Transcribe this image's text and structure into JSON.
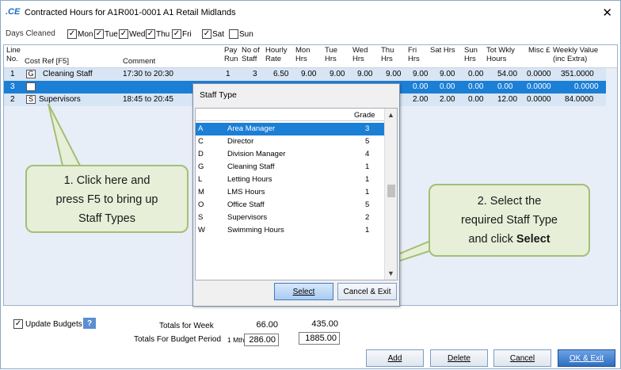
{
  "window": {
    "logo": ".CE",
    "title": "Contracted Hours for A1R001-0001 A1 Retail Midlands",
    "close_glyph": "✕"
  },
  "days": {
    "label": "Days Cleaned",
    "items": [
      {
        "label": "Mon",
        "checked": true
      },
      {
        "label": "Tue",
        "checked": true
      },
      {
        "label": "Wed",
        "checked": true
      },
      {
        "label": "Thu",
        "checked": true
      },
      {
        "label": "Fri",
        "checked": true
      },
      {
        "label": "Sat",
        "checked": true
      },
      {
        "label": "Sun",
        "checked": false
      }
    ]
  },
  "grid": {
    "headers": {
      "line": "Line No.",
      "cost_ref": "Cost Ref [F5]",
      "comment": "Comment",
      "pay_run": "Pay Run",
      "no_staff": "No of Staff",
      "hourly_rate": "Hourly Rate",
      "mon": "Mon Hrs",
      "tue": "Tue Hrs",
      "wed": "Wed Hrs",
      "thu": "Thu Hrs",
      "fri": "Fri Hrs",
      "sat": "Sat Hrs",
      "sun": "Sun Hrs",
      "tot": "Tot Wkly Hours",
      "misc": "Misc £",
      "weekly_value": "Weekly Value (inc Extra)"
    },
    "rows": [
      {
        "line": "1",
        "code": "G",
        "cost_ref": "Cleaning Staff",
        "comment": "17:30 to 20:30",
        "pay_run": "1",
        "no_staff": "3",
        "rate": "6.50",
        "mon": "9.00",
        "tue": "9.00",
        "wed": "9.00",
        "thu": "9.00",
        "fri": "9.00",
        "sat": "9.00",
        "sun": "0.00",
        "tot": "54.00",
        "misc": "0.0000",
        "value": "351.0000"
      },
      {
        "line": "3",
        "code": "",
        "cost_ref": "",
        "comment": "",
        "fri": "0.00",
        "sat": "0.00",
        "sun": "0.00",
        "tot": "0.00",
        "misc": "0.0000",
        "value": "0.0000"
      },
      {
        "line": "2",
        "code": "S",
        "cost_ref": "Supervisors",
        "comment": "18:45 to 20:45",
        "fri": "2.00",
        "sat": "2.00",
        "sun": "0.00",
        "tot": "12.00",
        "misc": "0.0000",
        "value": "84.0000"
      }
    ]
  },
  "popup": {
    "title": "Staff Type",
    "grade_header": "Grade",
    "items": [
      {
        "code": "A",
        "name": "Area Manager",
        "grade": "3"
      },
      {
        "code": "C",
        "name": "Director",
        "grade": "5"
      },
      {
        "code": "D",
        "name": "Division Manager",
        "grade": "4"
      },
      {
        "code": "G",
        "name": " Cleaning Staff",
        "grade": "1"
      },
      {
        "code": "L",
        "name": "Letting Hours",
        "grade": "1"
      },
      {
        "code": "M",
        "name": "LMS Hours",
        "grade": "1"
      },
      {
        "code": "O",
        "name": "Office Staff",
        "grade": "5"
      },
      {
        "code": "S",
        "name": " Supervisors",
        "grade": "2"
      },
      {
        "code": "W",
        "name": "Swimming Hours",
        "grade": "1"
      }
    ],
    "select_label": "Select",
    "cancel_label": "Cancel & Exit"
  },
  "callouts": {
    "one_line1": "1.    Click here and",
    "one_line2": "press F5 to bring up",
    "one_line3": "Staff Types",
    "two_line1": "2.    Select the",
    "two_line2": "required Staff Type",
    "two_line3_prefix": "and click ",
    "two_line3_bold": "Select"
  },
  "footer": {
    "update_budgets": "Update Budgets",
    "help": "?",
    "totals_week_label": "Totals for Week",
    "totals_week_hours": "66.00",
    "totals_week_value": "435.00",
    "totals_budget_label": "Totals For Budget Period",
    "period_unit": "1 Mth",
    "budget_hours": "286.00",
    "budget_value": "1885.00",
    "add": "Add",
    "delete": "Delete",
    "cancel": "Cancel",
    "ok_exit": "OK & Exit"
  }
}
